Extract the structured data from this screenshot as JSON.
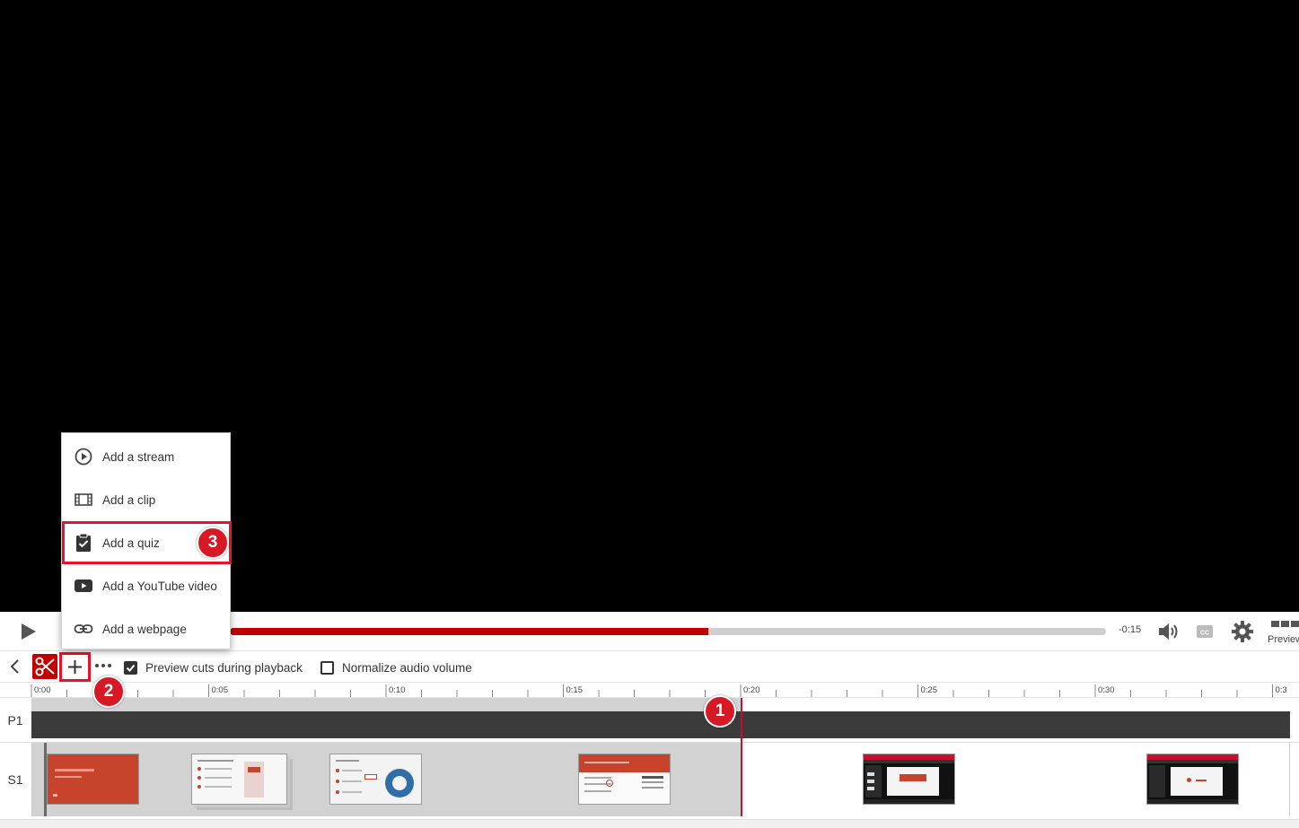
{
  "player": {
    "time_remaining": "-0:15",
    "progress_fraction": 0.546,
    "preview_label": "Preview"
  },
  "toolbar": {
    "preview_cuts_label": "Preview cuts during playback",
    "preview_cuts_checked": true,
    "normalize_audio_label": "Normalize audio volume",
    "normalize_audio_checked": false
  },
  "ruler": {
    "ticks": [
      "0:00",
      "0:05",
      "0:10",
      "0:15",
      "0:20",
      "0:25",
      "0:30",
      "0:3"
    ]
  },
  "tracks": {
    "p1_label": "P1",
    "s1_label": "S1"
  },
  "add_menu": {
    "items": [
      {
        "label": "Add a stream",
        "icon": "play-circle-icon"
      },
      {
        "label": "Add a clip",
        "icon": "film-icon"
      },
      {
        "label": "Add a quiz",
        "icon": "clipboard-check-icon"
      },
      {
        "label": "Add a YouTube video",
        "icon": "youtube-icon"
      },
      {
        "label": "Add a webpage",
        "icon": "link-icon"
      }
    ]
  },
  "callouts": [
    "1",
    "2",
    "3"
  ],
  "colors": {
    "accent": "#c00000",
    "highlight": "#e4142b"
  }
}
